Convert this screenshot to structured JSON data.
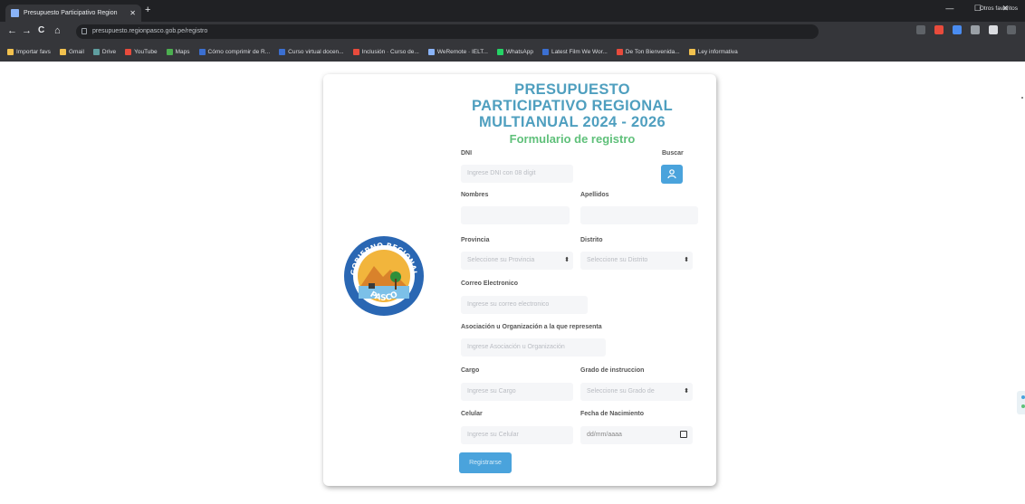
{
  "browser": {
    "tab_title": "Presupuesto Participativo Region",
    "tab_close": "✕",
    "new_tab": "+",
    "url": "presupuesto.regionpasco.gob.pe/registro",
    "back": "←",
    "forward": "→",
    "reload": "C",
    "home": "⌂",
    "window_controls": "— ☐ ✕",
    "bookmarks": [
      {
        "label": "Importar favs",
        "color": "#f2c14e"
      },
      {
        "label": "Gmail",
        "color": "#f2c14e"
      },
      {
        "label": "Drive",
        "color": "#5f9ea0"
      },
      {
        "label": "YouTube",
        "color": "#e84b3c"
      },
      {
        "label": "Maps",
        "color": "#4caf50"
      },
      {
        "label": "Cómo comprimir de R...",
        "color": "#3b6fd1"
      },
      {
        "label": "Curso virtual docen...",
        "color": "#3b6fd1"
      },
      {
        "label": "Inclusión · Curso de...",
        "color": "#e84b3c"
      },
      {
        "label": "WeRemote · IELT...",
        "color": "#8ab4f8"
      },
      {
        "label": "WhatsApp",
        "color": "#25d366"
      },
      {
        "label": "Latest Film We Wor...",
        "color": "#3b6fd1"
      },
      {
        "label": "De Ton Bienvenida...",
        "color": "#e84b3c"
      },
      {
        "label": "Ley informativa",
        "color": "#f2c14e"
      }
    ],
    "bookmarks_other": "Otros favoritos"
  },
  "form": {
    "title_lines": [
      "PRESUPUESTO",
      "PARTICIPATIVO REGIONAL",
      "MULTIANUAL 2024 - 2026"
    ],
    "subtitle": "Formulario de registro",
    "logo_text_top": "GOBIERNO REGIONAL",
    "logo_text_bottom": "PASCO",
    "dni_label": "DNI",
    "dni_placeholder": "Ingrese DNI con 08 dígit",
    "search_label": "Buscar",
    "nombres_label": "Nombres",
    "apellidos_label": "Apellidos",
    "provincia_label": "Provincia",
    "provincia_placeholder": "Seleccione su Provincia",
    "distrito_label": "Distrito",
    "distrito_placeholder": "Seleccione su Distrito",
    "correo_label": "Correo Electronico",
    "correo_placeholder": "Ingrese su correo electronico",
    "asociacion_label": "Asociación u Organización a la que representa",
    "asociacion_placeholder": "Ingrese Asociación u Organización",
    "cargo_label": "Cargo",
    "cargo_placeholder": "Ingrese su Cargo",
    "grado_label": "Grado de instruccion",
    "grado_placeholder": "Seleccione su Grado de",
    "celular_label": "Celular",
    "celular_placeholder": "Ingrese su Celular",
    "fecha_label": "Fecha de Nacimiento",
    "fecha_placeholder": "dd/mm/aaaa",
    "submit_label": "Registrarse",
    "select_caret": "⬍"
  },
  "colors": {
    "title": "#4f9fbf",
    "subtitle": "#5fc07a",
    "primary_button": "#4aa3dc"
  },
  "icons": {
    "search_button": "user-search-icon",
    "date_field": "calendar-icon"
  }
}
